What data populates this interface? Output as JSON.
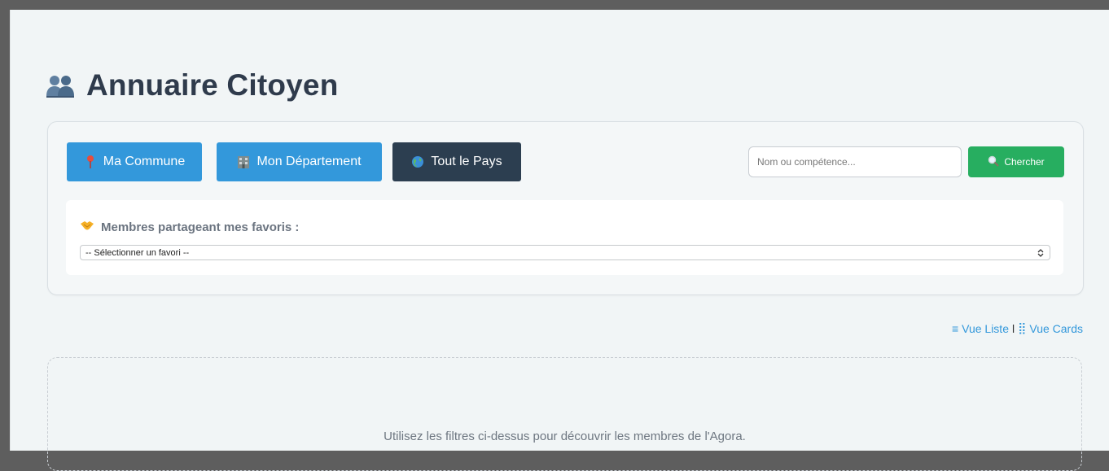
{
  "header": {
    "title": "Annuaire Citoyen",
    "icon": "users-icon"
  },
  "filters": {
    "buttons": [
      {
        "label": "Ma Commune",
        "icon": "pin-icon"
      },
      {
        "label": "Mon Département",
        "icon": "building-icon"
      },
      {
        "label": "Tout le Pays",
        "icon": "globe-icon"
      }
    ],
    "search": {
      "placeholder": "Nom ou compétence...",
      "value": ""
    },
    "search_button": {
      "label": "Chercher",
      "icon": "magnifier-icon"
    }
  },
  "favorites": {
    "label": "Membres partageant mes favoris :",
    "icon": "handshake-icon",
    "select_value": "-- Sélectionner un favori --"
  },
  "view_toggle": {
    "list_label": "Vue Liste",
    "separator": "l",
    "cards_label": "Vue Cards"
  },
  "results": {
    "empty_message": "Utilisez les filtres ci-dessus pour découvrir les membres de l'Agora."
  },
  "colors": {
    "accent_blue": "#3398db",
    "dark": "#2c3e50",
    "green": "#27ae60",
    "title": "#2f3b4c"
  }
}
